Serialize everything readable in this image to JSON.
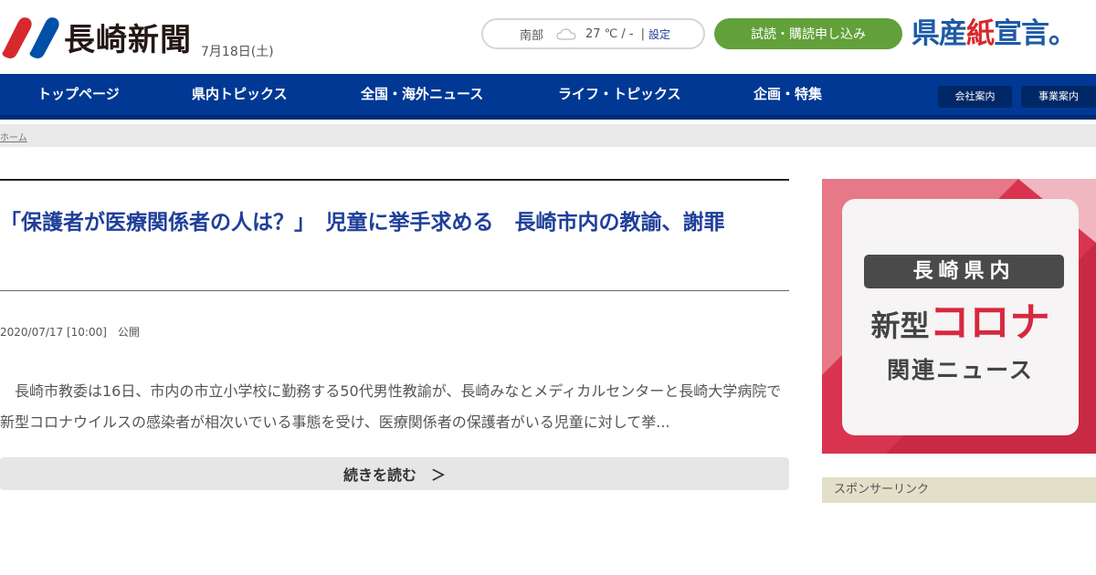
{
  "header": {
    "logo_text": "長崎新聞",
    "date": "7月18日(土)",
    "weather": {
      "region": "南部",
      "icon": "cloud-icon",
      "temperature": "27 ℃ / -",
      "separator": "|",
      "settings_label": "設定"
    },
    "subscribe_label": "試読・購読申し込み",
    "campaign": {
      "part1": "県産",
      "part2": "紙",
      "part3": "宣言。"
    }
  },
  "nav": {
    "items": [
      {
        "label": "トップページ"
      },
      {
        "label": "県内トピックス"
      },
      {
        "label": "全国・海外ニュース"
      },
      {
        "label": "ライフ・トピックス"
      },
      {
        "label": "企画・特集"
      }
    ],
    "sub_items": [
      {
        "label": "会社案内"
      },
      {
        "label": "事業案内"
      }
    ]
  },
  "breadcrumb": {
    "home": "ホーム"
  },
  "article": {
    "title": "「保護者が医療関係者の人は？」　児童に挙手求める　長崎市内の教諭、謝罪",
    "meta": "2020/07/17 [10:00]　公開",
    "lead": "長崎市教委は16日、市内の市立小学校に勤務する50代男性教諭が、長崎みなとメディカルセンターと長崎大学病院で新型コロナウイルスの感染者が相次いでいる事態を受け、医療関係者の保護者がいる児童に対して挙...",
    "read_more": "続きを読む　＞"
  },
  "sidebar": {
    "banner": {
      "line1": "長崎県内",
      "line2a": "新型",
      "line2b": "コロナ",
      "line3": "関連ニュース"
    },
    "sponsor_label": "スポンサーリンク"
  },
  "colors": {
    "brand_blue": "#003894",
    "title_blue": "#1f3f99",
    "subscribe_green": "#62a13a",
    "banner_red": "#d8344f"
  }
}
